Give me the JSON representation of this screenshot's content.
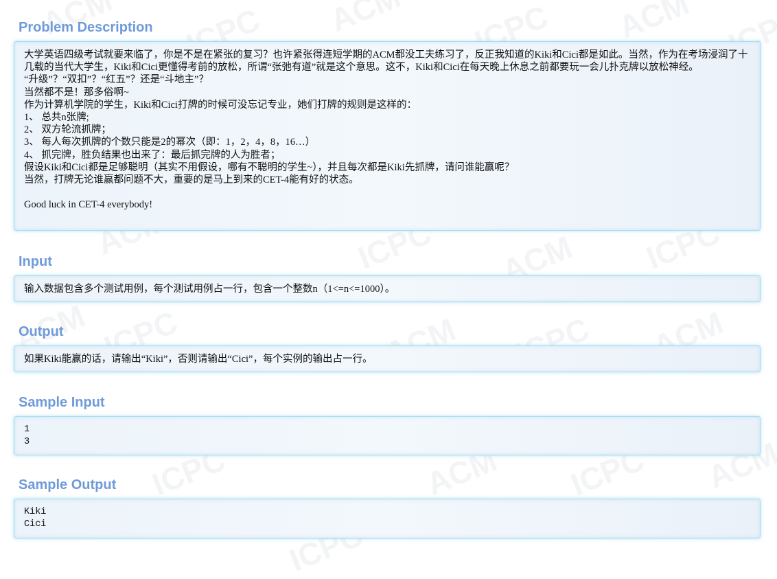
{
  "sections": {
    "description": {
      "title": "Problem Description",
      "lines": [
        "大学英语四级考试就要来临了，你是不是在紧张的复习？也许紧张得连短学期的ACM都没工夫练习了，反正我知道的Kiki和Cici都是如此。当然，作为在考场浸润了十几载的当代大学生，Kiki和Cici更懂得考前的放松，所谓“张弛有道”就是这个意思。这不，Kiki和Cici在每天晚上休息之前都要玩一会儿扑克牌以放松神经。",
        "“升级”？“双扣”？“红五”？还是“斗地主”？",
        "当然都不是！那多俗啊~",
        "作为计算机学院的学生，Kiki和Cici打牌的时候可没忘记专业，她们打牌的规则是这样的：",
        "1、 总共n张牌;",
        "2、 双方轮流抓牌；",
        "3、 每人每次抓牌的个数只能是2的幂次（即：1，2，4，8，16…）",
        "4、 抓完牌，胜负结果也出来了：最后抓完牌的人为胜者；",
        "假设Kiki和Cici都是足够聪明（其实不用假设，哪有不聪明的学生~），并且每次都是Kiki先抓牌，请问谁能赢呢？",
        "当然，打牌无论谁赢都问题不大，重要的是马上到来的CET-4能有好的状态。",
        "",
        "Good luck in CET-4 everybody!"
      ]
    },
    "input": {
      "title": "Input",
      "text": "输入数据包含多个测试用例，每个测试用例占一行，包含一个整数n（1<=n<=1000）。"
    },
    "output": {
      "title": "Output",
      "text": "如果Kiki能赢的话，请输出“Kiki”，否则请输出“Cici”，每个实例的输出占一行。"
    },
    "sample_input": {
      "title": "Sample Input",
      "lines": [
        "1",
        "3"
      ]
    },
    "sample_output": {
      "title": "Sample Output",
      "lines": [
        "Kiki",
        "Cici"
      ]
    }
  },
  "watermark": {
    "words": [
      "ACM",
      "ICPC",
      "ACM",
      "ICPC",
      "ACM",
      "ICPC",
      "ACM",
      "ICPC",
      "ACM",
      "ICPC",
      "ACM",
      "ICPC",
      "ACM",
      "ICPC",
      "ACM",
      "ICPC",
      "ACM",
      "ICPC",
      "ACM",
      "ICPC"
    ]
  },
  "colors": {
    "title": "#6f9ad9",
    "panel_border": "#a8dcf0",
    "panel_bg": "#ecf3fa"
  }
}
